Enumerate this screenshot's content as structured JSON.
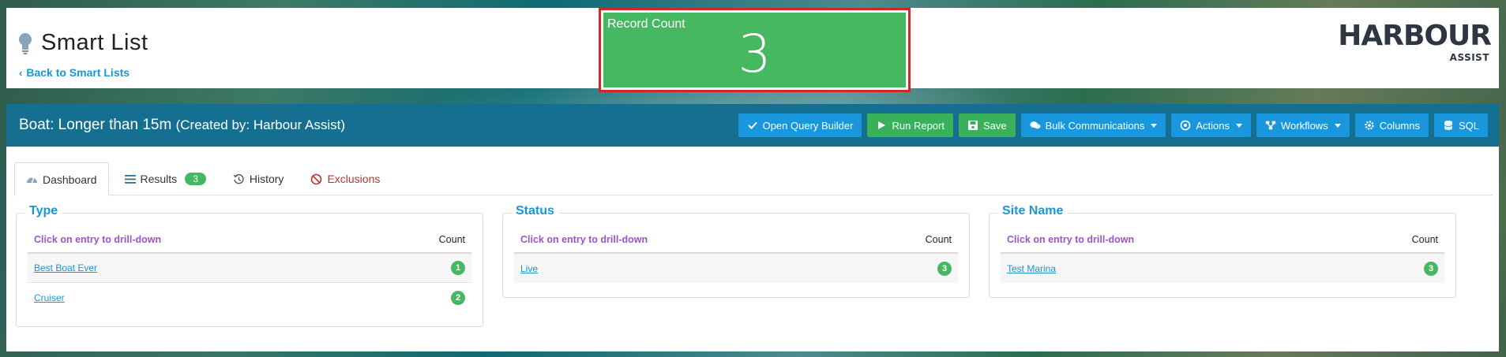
{
  "header": {
    "page_title": "Smart List",
    "back_link": "Back to Smart Lists",
    "logo_text": "HARBOUR",
    "logo_sub": "ASSIST"
  },
  "record_count": {
    "label": "Record Count",
    "value": "3"
  },
  "report": {
    "title": "Boat: Longer than 15m",
    "creator": "(Created by: Harbour Assist)"
  },
  "toolbar": {
    "open_query_builder": "Open Query Builder",
    "run_report": "Run Report",
    "save": "Save",
    "bulk_communications": "Bulk Communications",
    "actions": "Actions",
    "workflows": "Workflows",
    "columns": "Columns",
    "sql": "SQL"
  },
  "tabs": {
    "dashboard": "Dashboard",
    "results": "Results",
    "results_count": "3",
    "history": "History",
    "exclusions": "Exclusions"
  },
  "panels": [
    {
      "title": "Type",
      "hint": "Click on entry to drill-down",
      "count_header": "Count",
      "rows": [
        {
          "label": "Best Boat Ever",
          "count": "1"
        },
        {
          "label": "Cruiser",
          "count": "2"
        }
      ]
    },
    {
      "title": "Status",
      "hint": "Click on entry to drill-down",
      "count_header": "Count",
      "rows": [
        {
          "label": "Live",
          "count": "3"
        }
      ]
    },
    {
      "title": "Site Name",
      "hint": "Click on entry to drill-down",
      "count_header": "Count",
      "rows": [
        {
          "label": "Test Marina",
          "count": "3"
        }
      ]
    }
  ],
  "colors": {
    "accent_blue": "#1a97dc",
    "report_bar": "#156f91",
    "success_green": "#47b862",
    "highlight_red": "#cc2a2a",
    "hint_purple": "#9b55c9"
  }
}
